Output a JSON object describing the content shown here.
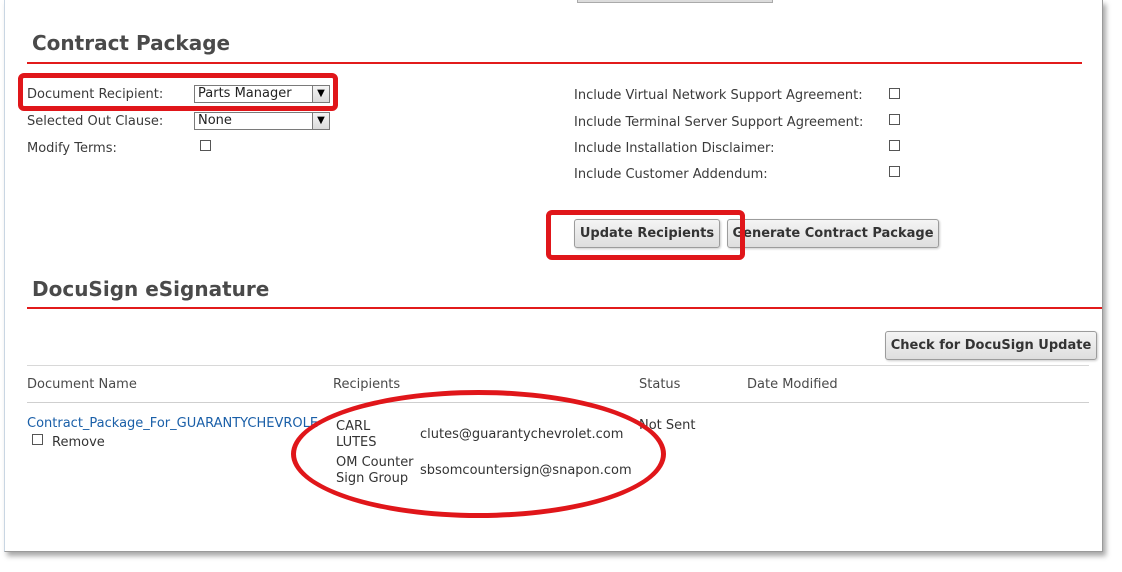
{
  "contract_package": {
    "title": "Contract Package",
    "document_recipient_label": "Document Recipient:",
    "document_recipient_value": "Parts Manager",
    "out_clause_label": "Selected Out Clause:",
    "out_clause_value": "None",
    "modify_terms_label": "Modify Terms:",
    "options": [
      {
        "label": "Include Virtual Network Support Agreement:",
        "checked": false
      },
      {
        "label": "Include Terminal Server Support Agreement:",
        "checked": false
      },
      {
        "label": "Include Installation Disclaimer:",
        "checked": false
      },
      {
        "label": "Include Customer Addendum:",
        "checked": false
      }
    ],
    "update_recipients_label": "Update Recipients",
    "generate_package_label": "Generate Contract Package"
  },
  "docusign": {
    "title": "DocuSign eSignature",
    "check_update_label": "Check for DocuSign Update",
    "columns": [
      "Document Name",
      "Recipients",
      "Status",
      "Date Modified"
    ],
    "row": {
      "document_name": "Contract_Package_For_GUARANTYCHEVROLE",
      "remove_label": "Remove",
      "status": "Not Sent",
      "recipients": [
        {
          "name_line1": "CARL",
          "name_line2": "LUTES",
          "email": "clutes@guarantychevrolet.com"
        },
        {
          "name_line1": "OM Counter",
          "name_line2": "Sign Group",
          "email": "sbsomcountersign@snapon.com"
        }
      ]
    }
  },
  "colors": {
    "accent": "#e21b1b",
    "annotation": "#e0161a",
    "link": "#1a5fa8"
  },
  "icons": {
    "select_arrow": "chevron-down-icon"
  }
}
